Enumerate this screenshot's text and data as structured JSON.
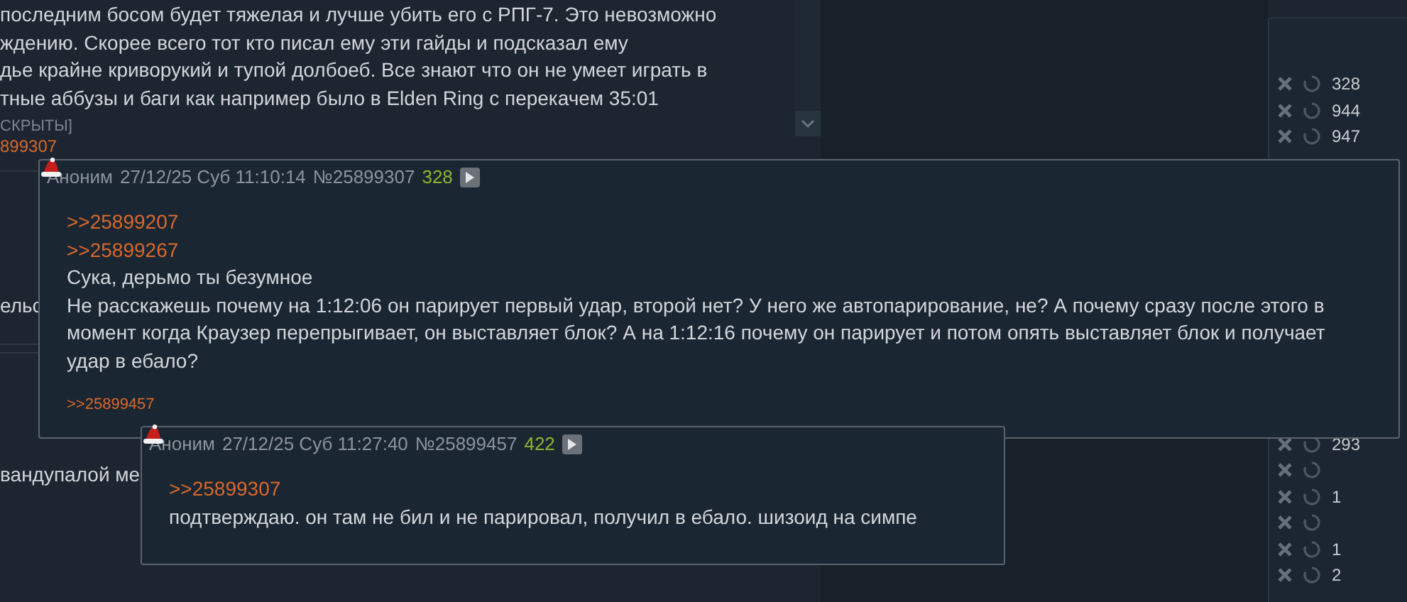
{
  "background_post": {
    "lines": [
      "последним босом будет тяжелая и лучше убить его с РПГ-7. Это невозможно",
      "ждению. Скорее всего тот кто писал ему эти гайды и подсказал ему",
      "дье крайне криворукий и тупой долбоеб. Все знают что он не умеет играть в",
      "тные аббузы и баги как например было в Elden Ring с перекачем 35:01"
    ],
    "hidden_note": "СКРЫТЫ]",
    "reply_link": "899307"
  },
  "background_fragments": [
    "ельс",
    "вандупалой ме"
  ],
  "side_panel": {
    "rows_top": [
      {
        "count": "328"
      },
      {
        "count": "944"
      },
      {
        "count": "947"
      }
    ],
    "rows_bottom": [
      {
        "kind": "count",
        "count": "293"
      },
      {
        "kind": "icons"
      },
      {
        "kind": "count",
        "count": "1"
      },
      {
        "kind": "icons"
      },
      {
        "kind": "count",
        "count": "1"
      },
      {
        "kind": "count",
        "count": "2"
      }
    ]
  },
  "popups": [
    {
      "author": "Аноним",
      "datetime": "27/12/25 Суб 11:10:14",
      "number": "№25899307",
      "reply_count": "328",
      "links": [
        ">>25899207",
        ">>25899267"
      ],
      "paragraphs": [
        "Сука, дерьмо ты безумное",
        "Не расскажешь почему на 1:12:06 он парирует первый удар, второй нет? У него же автопарирование, не? А почему сразу после этого в момент когда Краузер перепрыгивает, он выставляет блок? А на 1:12:16 почему он парирует и потом опять выставляет блок и получает удар в ебало?"
      ],
      "backlinks": [
        ">>25899457"
      ]
    },
    {
      "author": "Аноним",
      "datetime": "27/12/25 Суб 11:27:40",
      "number": "№25899457",
      "reply_count": "422",
      "links": [
        ">>25899307"
      ],
      "paragraphs": [
        "подтверждаю. он там не бил и не парировал, получил в ебало. шизоид на симпе"
      ]
    }
  ]
}
